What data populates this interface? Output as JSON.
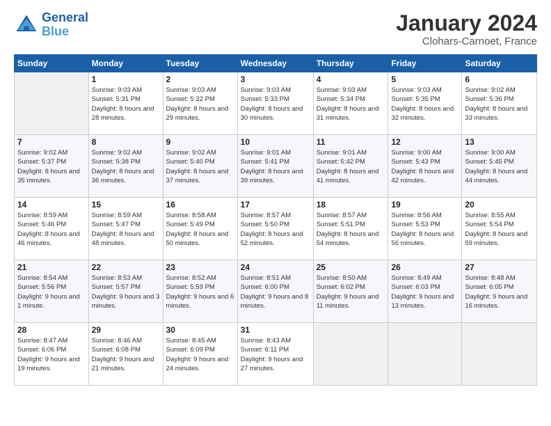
{
  "logo": {
    "line1": "General",
    "line2": "Blue"
  },
  "title": "January 2024",
  "subtitle": "Clohars-Carnoet, France",
  "days_header": [
    "Sunday",
    "Monday",
    "Tuesday",
    "Wednesday",
    "Thursday",
    "Friday",
    "Saturday"
  ],
  "weeks": [
    [
      {
        "num": "",
        "sunrise": "",
        "sunset": "",
        "daylight": ""
      },
      {
        "num": "1",
        "sunrise": "Sunrise: 9:03 AM",
        "sunset": "Sunset: 5:31 PM",
        "daylight": "Daylight: 8 hours and 28 minutes."
      },
      {
        "num": "2",
        "sunrise": "Sunrise: 9:03 AM",
        "sunset": "Sunset: 5:32 PM",
        "daylight": "Daylight: 8 hours and 29 minutes."
      },
      {
        "num": "3",
        "sunrise": "Sunrise: 9:03 AM",
        "sunset": "Sunset: 5:33 PM",
        "daylight": "Daylight: 8 hours and 30 minutes."
      },
      {
        "num": "4",
        "sunrise": "Sunrise: 9:03 AM",
        "sunset": "Sunset: 5:34 PM",
        "daylight": "Daylight: 8 hours and 31 minutes."
      },
      {
        "num": "5",
        "sunrise": "Sunrise: 9:03 AM",
        "sunset": "Sunset: 5:35 PM",
        "daylight": "Daylight: 8 hours and 32 minutes."
      },
      {
        "num": "6",
        "sunrise": "Sunrise: 9:02 AM",
        "sunset": "Sunset: 5:36 PM",
        "daylight": "Daylight: 8 hours and 33 minutes."
      }
    ],
    [
      {
        "num": "7",
        "sunrise": "Sunrise: 9:02 AM",
        "sunset": "Sunset: 5:37 PM",
        "daylight": "Daylight: 8 hours and 35 minutes."
      },
      {
        "num": "8",
        "sunrise": "Sunrise: 9:02 AM",
        "sunset": "Sunset: 5:38 PM",
        "daylight": "Daylight: 8 hours and 36 minutes."
      },
      {
        "num": "9",
        "sunrise": "Sunrise: 9:02 AM",
        "sunset": "Sunset: 5:40 PM",
        "daylight": "Daylight: 8 hours and 37 minutes."
      },
      {
        "num": "10",
        "sunrise": "Sunrise: 9:01 AM",
        "sunset": "Sunset: 5:41 PM",
        "daylight": "Daylight: 8 hours and 39 minutes."
      },
      {
        "num": "11",
        "sunrise": "Sunrise: 9:01 AM",
        "sunset": "Sunset: 5:42 PM",
        "daylight": "Daylight: 8 hours and 41 minutes."
      },
      {
        "num": "12",
        "sunrise": "Sunrise: 9:00 AM",
        "sunset": "Sunset: 5:43 PM",
        "daylight": "Daylight: 8 hours and 42 minutes."
      },
      {
        "num": "13",
        "sunrise": "Sunrise: 9:00 AM",
        "sunset": "Sunset: 5:45 PM",
        "daylight": "Daylight: 8 hours and 44 minutes."
      }
    ],
    [
      {
        "num": "14",
        "sunrise": "Sunrise: 8:59 AM",
        "sunset": "Sunset: 5:46 PM",
        "daylight": "Daylight: 8 hours and 46 minutes."
      },
      {
        "num": "15",
        "sunrise": "Sunrise: 8:59 AM",
        "sunset": "Sunset: 5:47 PM",
        "daylight": "Daylight: 8 hours and 48 minutes."
      },
      {
        "num": "16",
        "sunrise": "Sunrise: 8:58 AM",
        "sunset": "Sunset: 5:49 PM",
        "daylight": "Daylight: 8 hours and 50 minutes."
      },
      {
        "num": "17",
        "sunrise": "Sunrise: 8:57 AM",
        "sunset": "Sunset: 5:50 PM",
        "daylight": "Daylight: 8 hours and 52 minutes."
      },
      {
        "num": "18",
        "sunrise": "Sunrise: 8:57 AM",
        "sunset": "Sunset: 5:51 PM",
        "daylight": "Daylight: 8 hours and 54 minutes."
      },
      {
        "num": "19",
        "sunrise": "Sunrise: 8:56 AM",
        "sunset": "Sunset: 5:53 PM",
        "daylight": "Daylight: 8 hours and 56 minutes."
      },
      {
        "num": "20",
        "sunrise": "Sunrise: 8:55 AM",
        "sunset": "Sunset: 5:54 PM",
        "daylight": "Daylight: 8 hours and 59 minutes."
      }
    ],
    [
      {
        "num": "21",
        "sunrise": "Sunrise: 8:54 AM",
        "sunset": "Sunset: 5:56 PM",
        "daylight": "Daylight: 9 hours and 1 minute."
      },
      {
        "num": "22",
        "sunrise": "Sunrise: 8:53 AM",
        "sunset": "Sunset: 5:57 PM",
        "daylight": "Daylight: 9 hours and 3 minutes."
      },
      {
        "num": "23",
        "sunrise": "Sunrise: 8:52 AM",
        "sunset": "Sunset: 5:59 PM",
        "daylight": "Daylight: 9 hours and 6 minutes."
      },
      {
        "num": "24",
        "sunrise": "Sunrise: 8:51 AM",
        "sunset": "Sunset: 6:00 PM",
        "daylight": "Daylight: 9 hours and 8 minutes."
      },
      {
        "num": "25",
        "sunrise": "Sunrise: 8:50 AM",
        "sunset": "Sunset: 6:02 PM",
        "daylight": "Daylight: 9 hours and 11 minutes."
      },
      {
        "num": "26",
        "sunrise": "Sunrise: 8:49 AM",
        "sunset": "Sunset: 6:03 PM",
        "daylight": "Daylight: 9 hours and 13 minutes."
      },
      {
        "num": "27",
        "sunrise": "Sunrise: 8:48 AM",
        "sunset": "Sunset: 6:05 PM",
        "daylight": "Daylight: 9 hours and 16 minutes."
      }
    ],
    [
      {
        "num": "28",
        "sunrise": "Sunrise: 8:47 AM",
        "sunset": "Sunset: 6:06 PM",
        "daylight": "Daylight: 9 hours and 19 minutes."
      },
      {
        "num": "29",
        "sunrise": "Sunrise: 8:46 AM",
        "sunset": "Sunset: 6:08 PM",
        "daylight": "Daylight: 9 hours and 21 minutes."
      },
      {
        "num": "30",
        "sunrise": "Sunrise: 8:45 AM",
        "sunset": "Sunset: 6:09 PM",
        "daylight": "Daylight: 9 hours and 24 minutes."
      },
      {
        "num": "31",
        "sunrise": "Sunrise: 8:43 AM",
        "sunset": "Sunset: 6:11 PM",
        "daylight": "Daylight: 9 hours and 27 minutes."
      },
      {
        "num": "",
        "sunrise": "",
        "sunset": "",
        "daylight": ""
      },
      {
        "num": "",
        "sunrise": "",
        "sunset": "",
        "daylight": ""
      },
      {
        "num": "",
        "sunrise": "",
        "sunset": "",
        "daylight": ""
      }
    ]
  ]
}
